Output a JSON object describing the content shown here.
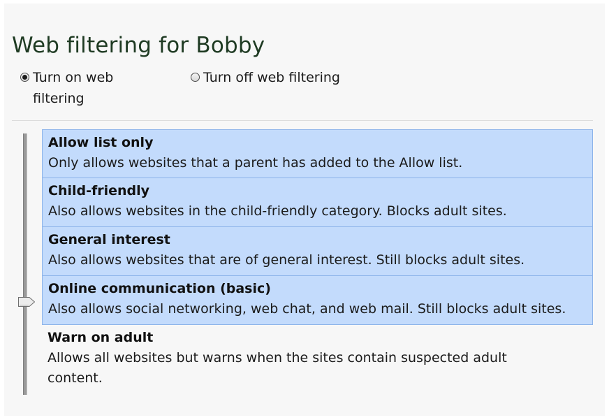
{
  "page": {
    "title": "Web filtering for Bobby"
  },
  "filter_toggle": {
    "on_label": "Turn on web filtering",
    "off_label": "Turn off web filtering",
    "selected": "on"
  },
  "levels": [
    {
      "title": "Allow list only",
      "description": "Only allows websites that a parent has added to the Allow list.",
      "highlighted": true
    },
    {
      "title": "Child-friendly",
      "description": "Also allows websites in the child-friendly category. Blocks adult sites.",
      "highlighted": true
    },
    {
      "title": "General interest",
      "description": "Also allows websites that are of general interest. Still blocks adult sites.",
      "highlighted": true
    },
    {
      "title": "Online communication (basic)",
      "description": "Also allows social networking, web chat, and web mail. Still blocks adult sites.",
      "highlighted": true
    },
    {
      "title": "Warn on adult",
      "description": "Allows all websites but warns when the sites contain suspected adult content.",
      "highlighted": false
    }
  ],
  "slider": {
    "selected_level_index": 3
  },
  "colors": {
    "highlight_fill": "#c3dbfc",
    "highlight_border": "#8db4ea",
    "title_color": "#1e3a22",
    "panel_background": "#f7f7f7"
  }
}
